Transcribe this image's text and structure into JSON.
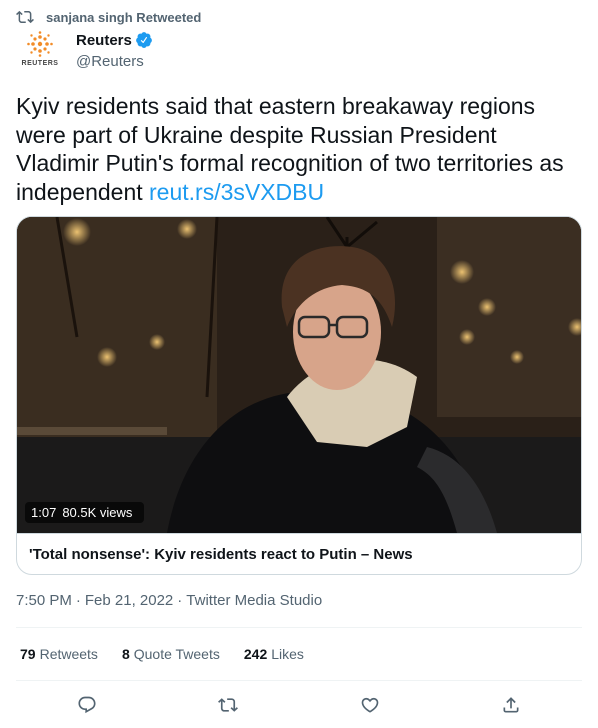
{
  "retweet_banner": {
    "text": "sanjana singh Retweeted",
    "icon": "retweet-icon"
  },
  "author": {
    "name": "Reuters",
    "handle": "@Reuters",
    "avatar_brand": "REUTERS",
    "verified": true,
    "accent_color": "#1d9bf0"
  },
  "tweet": {
    "text": "Kyiv residents said that eastern breakaway regions were part of Ukraine despite Russian President Vladimir Putin's formal recognition of two territories as independent ",
    "link": "reut.rs/3sVXDBU"
  },
  "media": {
    "duration": "1:07",
    "views": "80.5K views",
    "title": "'Total nonsense': Kyiv residents react to Putin – News"
  },
  "meta": {
    "time": "7:50 PM",
    "date": "Feb 21, 2022",
    "source": "Twitter Media Studio"
  },
  "stats": {
    "retweets_count": "79",
    "retweets_label": "Retweets",
    "quotes_count": "8",
    "quotes_label": "Quote Tweets",
    "likes_count": "242",
    "likes_label": "Likes"
  },
  "actions": [
    "reply-icon",
    "retweet-icon",
    "like-icon",
    "share-icon"
  ]
}
